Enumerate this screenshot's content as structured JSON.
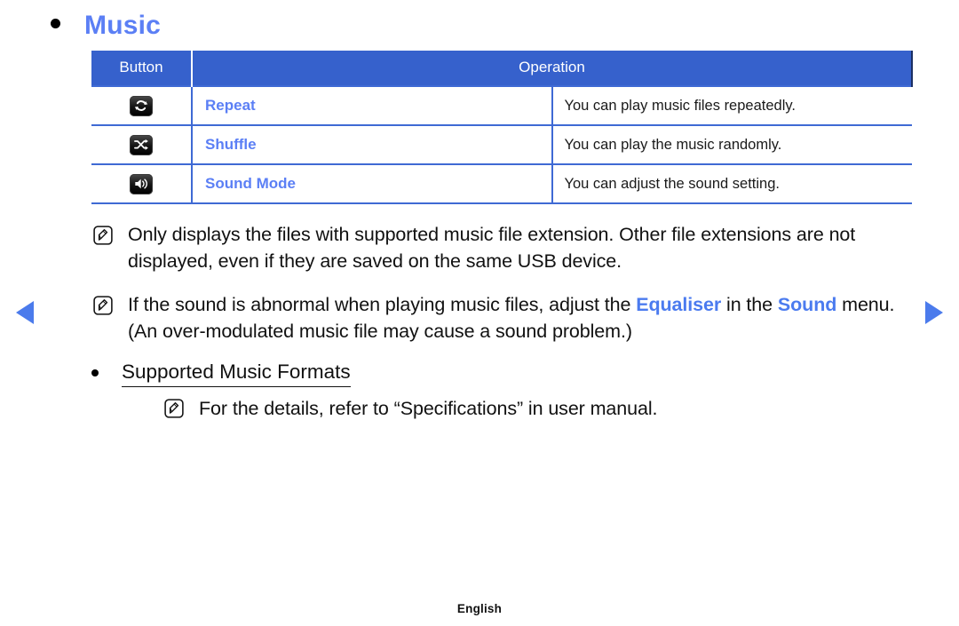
{
  "nav": {
    "prev_label": "prev-page-arrow",
    "next_label": "next-page-arrow"
  },
  "heading": {
    "title": "Music"
  },
  "table": {
    "headers": {
      "button": "Button",
      "operation": "Operation"
    },
    "rows": [
      {
        "icon": "repeat-icon",
        "label": "Repeat",
        "description": "You can play music files repeatedly."
      },
      {
        "icon": "shuffle-icon",
        "label": "Shuffle",
        "description": "You can play the music randomly."
      },
      {
        "icon": "sound-mode-icon",
        "label": "Sound Mode",
        "description": "You can adjust the sound setting."
      }
    ]
  },
  "notes": [
    {
      "icon": "note-icon",
      "text": "Only displays the files with supported music file extension. Other file extensions are not displayed, even if they are saved on the same USB device."
    }
  ],
  "note_equaliser": {
    "icon": "note-icon",
    "part1": "If the sound is abnormal when playing music files, adjust the ",
    "kw1": "Equaliser",
    "part2": " in the ",
    "kw2": "Sound",
    "part3": " menu. (An over-modulated music file may cause a sound problem.)"
  },
  "subsection": {
    "title": "Supported Music Formats",
    "note": {
      "icon": "note-icon",
      "text": "For the details, refer to “Specifications” in user manual."
    }
  },
  "footer": {
    "language": "English"
  },
  "colors": {
    "header_blue": "#3661cc",
    "link_blue": "#5b7ff5",
    "rule_blue": "#3f6ad4",
    "arrow_blue": "#4b7bec",
    "text_black": "#111111"
  }
}
